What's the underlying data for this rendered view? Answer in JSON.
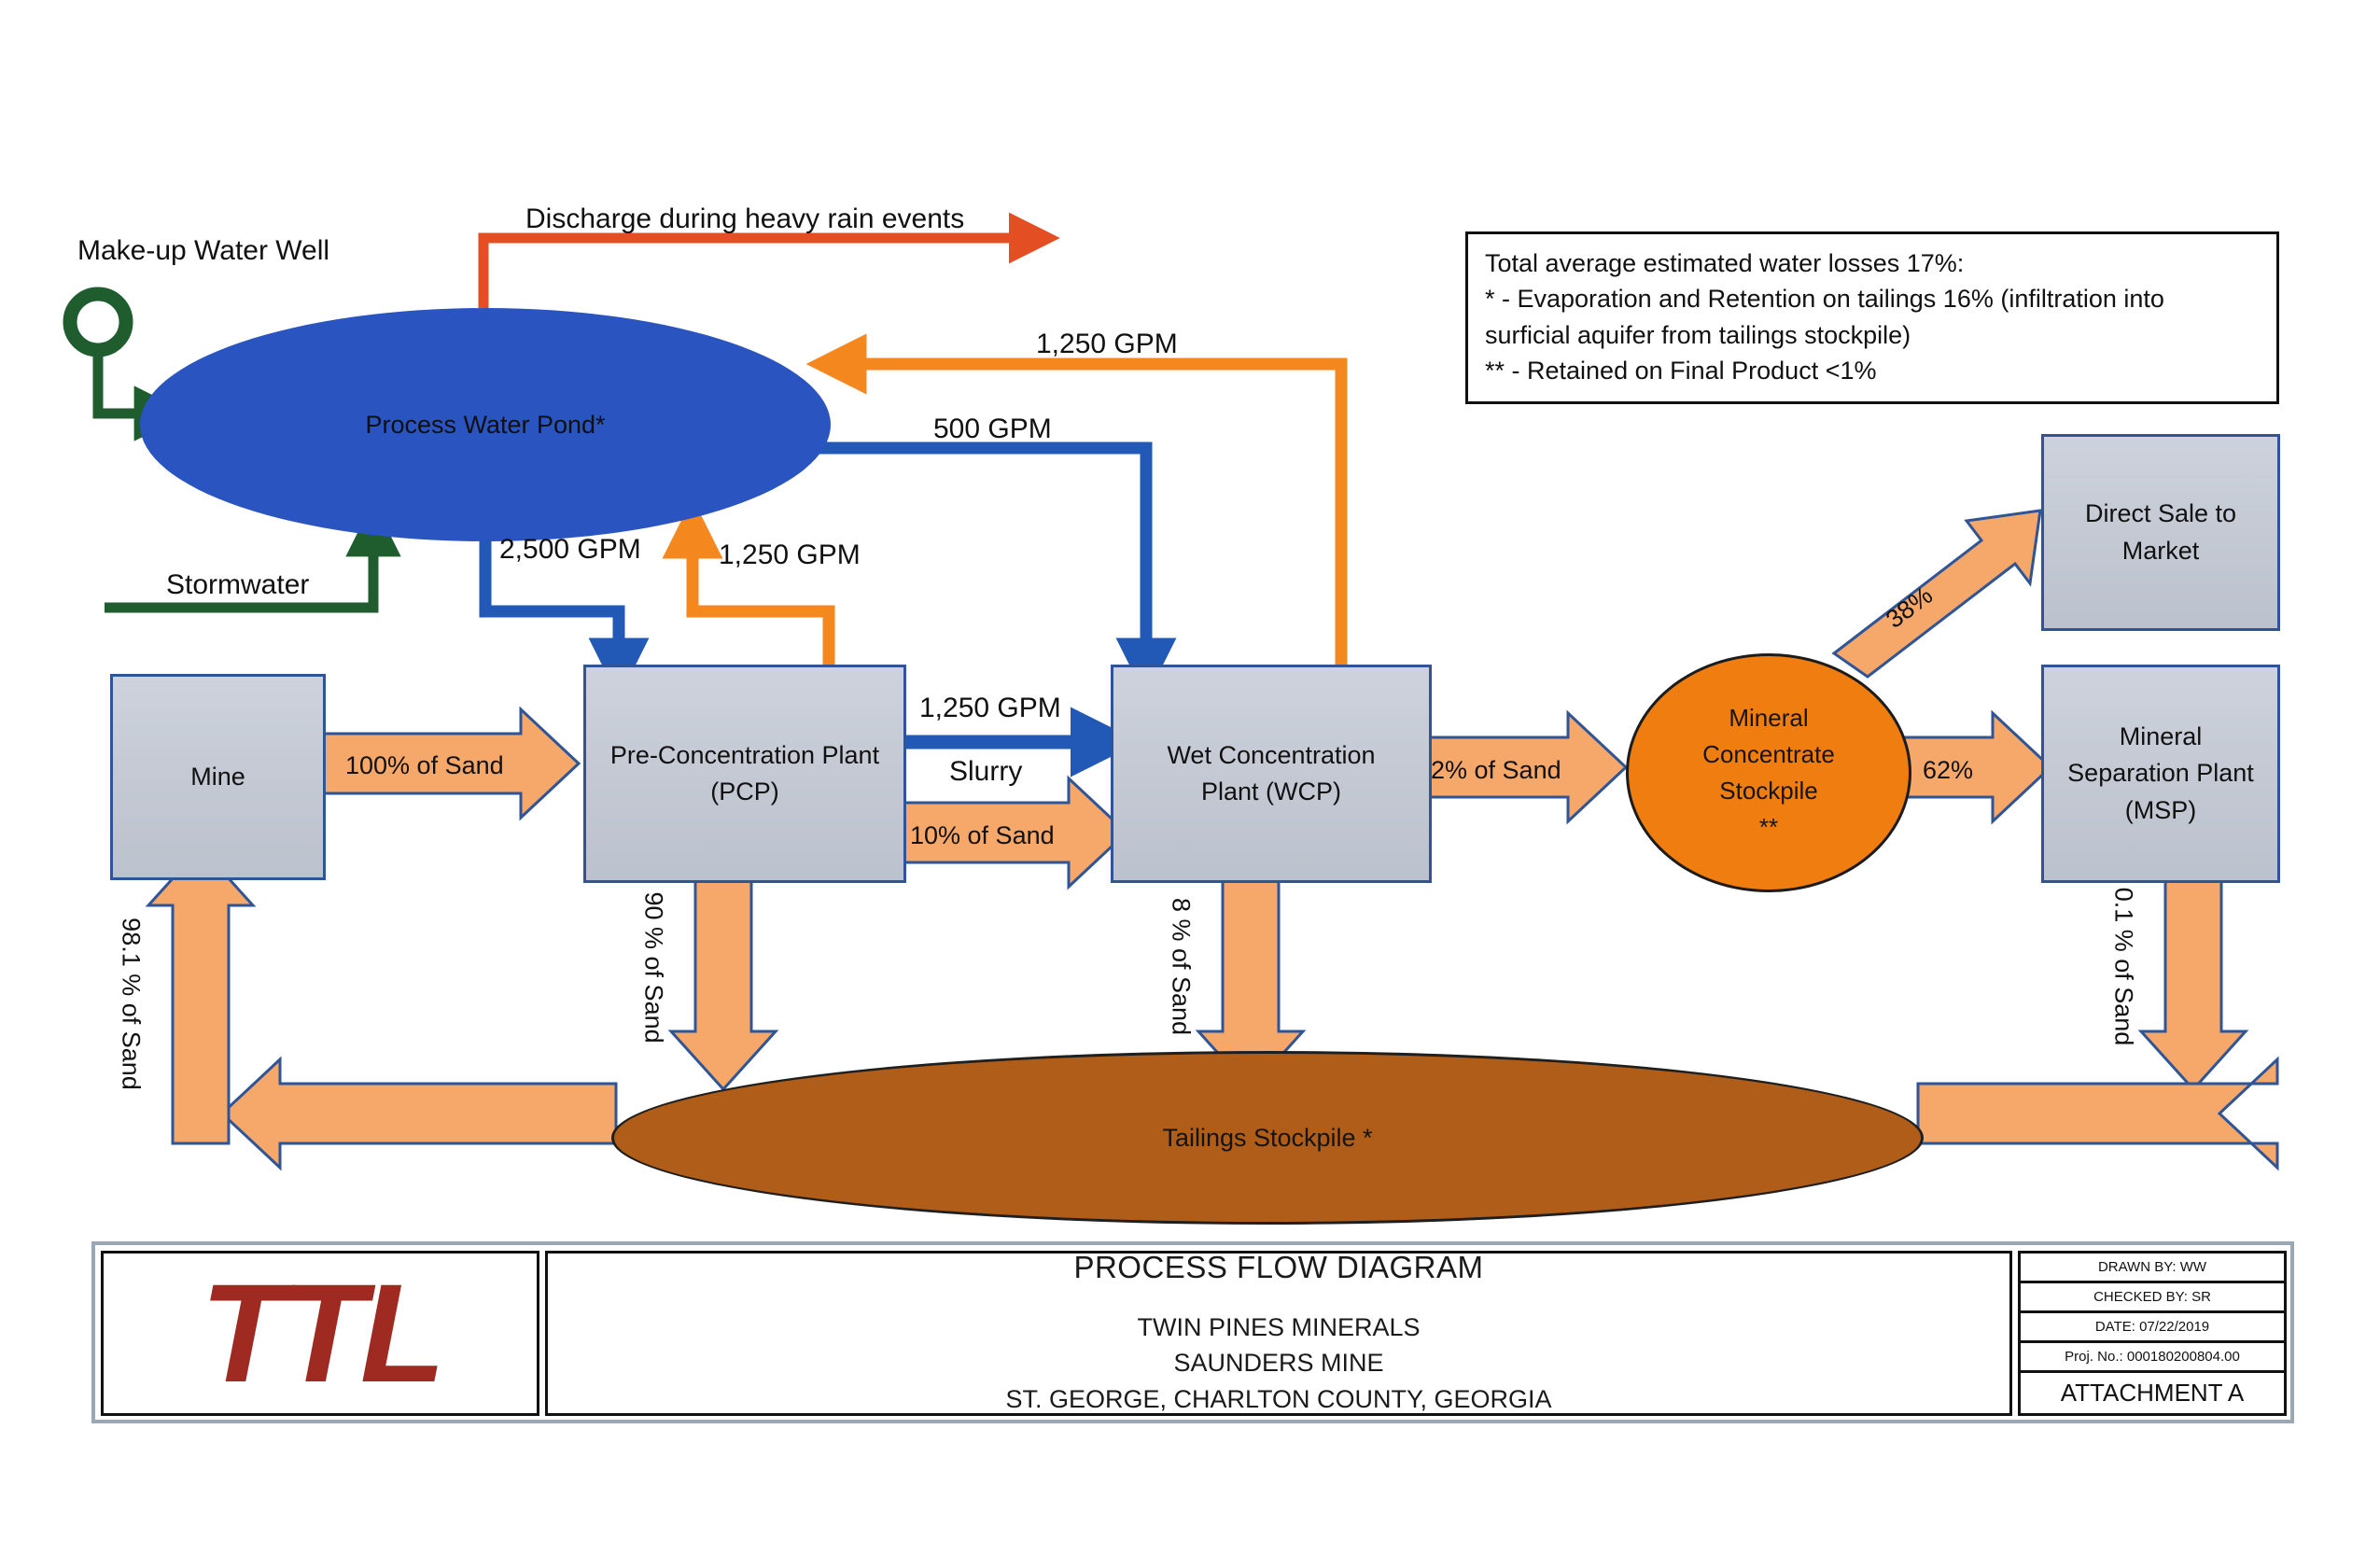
{
  "nodes": {
    "mine": "Mine",
    "pcp": "Pre-Concentration Plant\n(PCP)",
    "pcp_l1": "Pre-Concentration Plant",
    "pcp_l2": "(PCP)",
    "wcp_l1": "Wet Concentration",
    "wcp_l2": "Plant (WCP)",
    "pond": "Process Water Pond*",
    "stockpile_l1": "Mineral",
    "stockpile_l2": "Concentrate",
    "stockpile_l3": "Stockpile",
    "stockpile_l4": "**",
    "direct_sale_l1": "Direct Sale to",
    "direct_sale_l2": "Market",
    "msp_l1": "Mineral",
    "msp_l2": "Separation Plant",
    "msp_l3": "(MSP)",
    "tailings": "Tailings Stockpile *",
    "well": "Make-up Water Well",
    "stormwater": "Stormwater"
  },
  "flows": {
    "discharge": "Discharge during heavy rain events",
    "gpm_2500": "2,500 GPM",
    "gpm_1250_pcp": "1,250 GPM",
    "gpm_1250_wcp_return": "1,250 GPM",
    "gpm_500": "500 GPM",
    "gpm_1250_slurry": "1,250 GPM",
    "slurry": "Slurry",
    "sand_100": "100% of Sand",
    "sand_10": "10% of Sand",
    "sand_2": "2% of Sand",
    "sand_90": "90 % of Sand",
    "sand_8": "8 % of Sand",
    "sand_98_1": "98.1 % of Sand",
    "sand_0_1": "0.1 % of Sand",
    "pct_38": "38%",
    "pct_62": "62%"
  },
  "legend": {
    "line1": "Total average estimated  water losses 17%:",
    "line2": "*   - Evaporation  and Retention on tailings 16% (infiltration into",
    "line3": "surficial aquifer from tailings stockpile)",
    "line4": "** - Retained on Final Product <1%"
  },
  "title_block": {
    "logo": "TTL",
    "title": "PROCESS FLOW DIAGRAM",
    "sub1": "TWIN PINES MINERALS",
    "sub2": "SAUNDERS MINE",
    "sub3": "ST. GEORGE, CHARLTON COUNTY, GEORGIA",
    "drawn_by": "DRAWN BY: WW",
    "checked_by": "CHECKED BY: SR",
    "date": "DATE: 07/22/2019",
    "proj_no": "Proj. No.: 000180200804.00",
    "attachment": "ATTACHMENT A"
  },
  "colors": {
    "pond_blue": "#2a55c0",
    "water_blue": "#2259b6",
    "recycle_orange": "#f5871f",
    "discharge_red": "#e34f22",
    "stormwater_green": "#1f5c2e",
    "sand_arrow": "#f5a86a",
    "sand_arrow_border": "#2f5596",
    "box_gray": "#c3c8d3",
    "stockpile_orange": "#ef7d10",
    "tailings_brown": "#b05d19",
    "logo_red": "#9e2a21"
  }
}
